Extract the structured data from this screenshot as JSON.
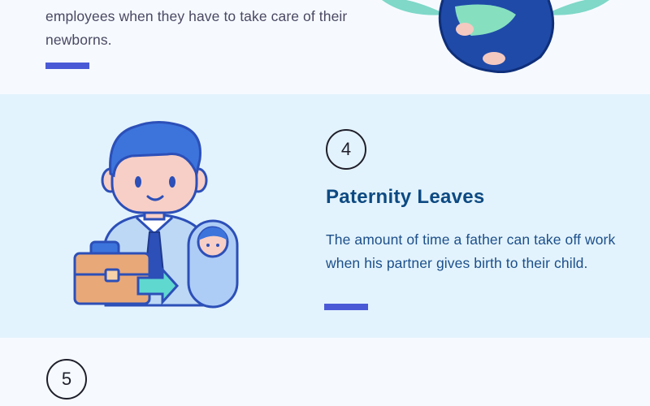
{
  "top_section": {
    "description": "employees when they have to take care of their newborns."
  },
  "paternity": {
    "step_number": "4",
    "title": "Paternity Leaves",
    "description": "The amount of time a father can take off work when his partner gives birth to their child."
  },
  "next_section": {
    "step_number": "5"
  },
  "colors": {
    "accent": "#4a5ad6",
    "heading": "#0d4a82",
    "highlight_band": "#e3f3fd"
  }
}
